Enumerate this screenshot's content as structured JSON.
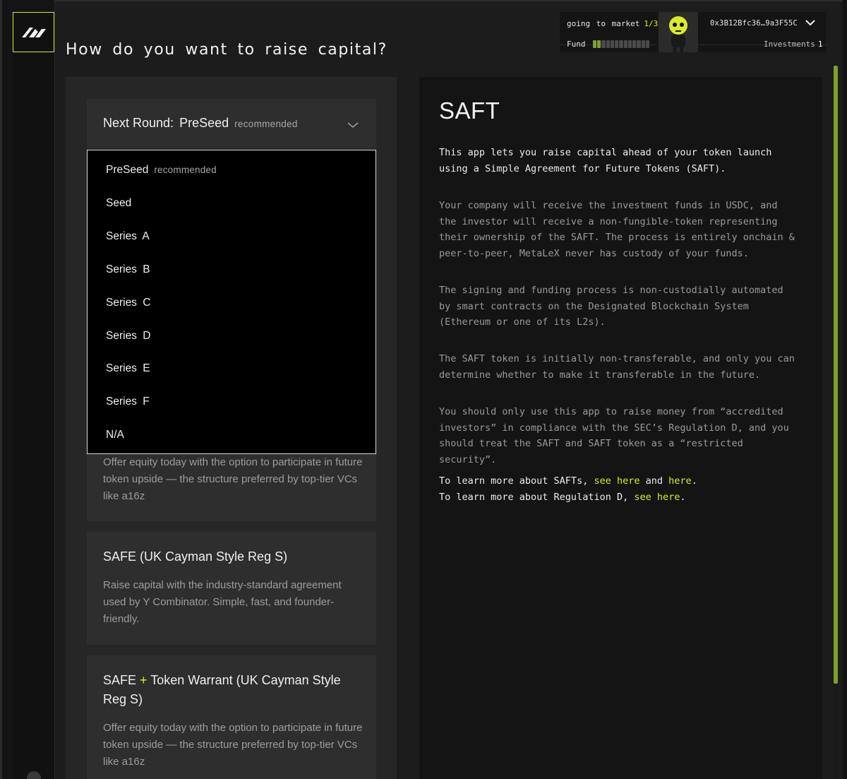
{
  "app": {
    "page_title": "How do you want to raise capital?",
    "accent_color": "#d8ec2c",
    "logo_icon": "metalex-logo-icon"
  },
  "header": {
    "progress_label": "going to market",
    "progress_count": "1/3",
    "fund_label": "Fund",
    "fund_level": 0.15,
    "wallet_address": "0x3B12Bfc36…9a3F55C",
    "investments_label": "Investments",
    "investments_count": "1"
  },
  "round_select": {
    "label": "Next Round:",
    "value": "PreSeed",
    "badge": "recommended"
  },
  "dropdown": {
    "options": [
      {
        "label": "PreSeed",
        "badge": "recommended"
      },
      {
        "label": "Seed",
        "badge": ""
      },
      {
        "label": "Series A",
        "badge": ""
      },
      {
        "label": "Series B",
        "badge": ""
      },
      {
        "label": "Series C",
        "badge": ""
      },
      {
        "label": "Series D",
        "badge": ""
      },
      {
        "label": "Series E",
        "badge": ""
      },
      {
        "label": "Series F",
        "badge": ""
      },
      {
        "label": "N/A",
        "badge": ""
      }
    ]
  },
  "cards": [
    {
      "title": "",
      "description": "Offer equity today with the option to participate in future token upside — the structure preferred by top-tier VCs like a16z"
    },
    {
      "title": "SAFE (UK Cayman Style Reg S)",
      "description": "Raise capital with the industry-standard agreement used by Y Combinator. Simple, fast, and founder-friendly."
    },
    {
      "title_before": "SAFE",
      "title_plus": "+",
      "title_after": "Token Warrant (UK Cayman Style Reg S)",
      "description": "Offer equity today with the option to participate in future token upside — the structure preferred by top-tier VCs like a16z"
    }
  ],
  "info": {
    "title": "SAFT",
    "p1": "This app lets you raise capital ahead of your token launch using a Simple Agreement for Future Tokens (SAFT).",
    "p2": "Your company will receive the investment funds in USDC, and the investor will receive a non-fungible-token representing their ownership of the SAFT. The process is entirely onchain & peer-to-peer, MetaLeX never has custody of your funds.",
    "p3": "The signing and funding process is non-custodially automated by smart contracts on the Designated Blockchain System (Ethereum or one of its L2s).",
    "p4": "The SAFT token is initially non-transferable, and only you can determine whether to make it transferable in the future.",
    "p5": "You should only use this app to raise money from “accredited investors” in compliance with the SEC’s Regulation D, and you should treat the SAFT and SAFT token as a “restricted security”.",
    "learn1_prefix": "To learn more about SAFTs,",
    "learn1_link1": "see here",
    "learn1_and": "and",
    "learn1_link2": "here",
    "learn2_prefix": "To learn more about Regulation D,",
    "learn2_link1": "see",
    "learn2_link2": "here",
    "period": "."
  }
}
